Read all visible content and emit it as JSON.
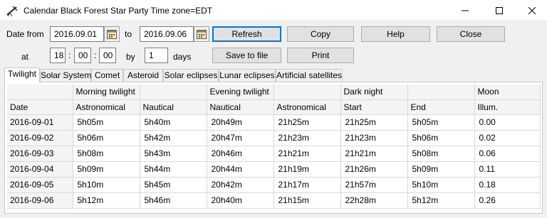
{
  "window": {
    "title": "Calendar Black Forest Star Party Time zone=EDT",
    "app_icon": "telescope-icon",
    "controls": [
      "minimize-icon",
      "maximize-icon",
      "close-icon"
    ]
  },
  "form": {
    "date_from_label": "Date from",
    "date_from": "2016.09.01",
    "to_label": "to",
    "date_to": "2016.09.06",
    "at_label": "at",
    "hour": "18",
    "minute": "00",
    "second": "00",
    "sep1": ":",
    "sep2": ":",
    "by_label": "by",
    "step": "1",
    "days_label": "days",
    "calendar_icon": "calendar-icon"
  },
  "buttons": {
    "refresh": "Refresh",
    "copy": "Copy",
    "help": "Help",
    "close": "Close",
    "save": "Save to file",
    "print": "Print"
  },
  "tabs": [
    "Twilight",
    "Solar System",
    "Comet",
    "Asteroid",
    "Solar eclipses",
    "Lunar eclipses",
    "Artificial satellites"
  ],
  "active_tab": "Twilight",
  "table": {
    "group_headers": [
      "",
      "Morning twilight",
      "",
      "Evening twilight",
      "",
      "Dark night",
      "",
      "Moon"
    ],
    "columns": [
      "Date",
      "Astronomical",
      "Nautical",
      "Nautical",
      "Astronomical",
      "Start",
      "End",
      "Illum."
    ],
    "rows": [
      [
        "2016-09-01",
        "5h05m",
        "5h40m",
        "20h49m",
        "21h25m",
        "21h25m",
        "5h05m",
        "0.00"
      ],
      [
        "2016-09-02",
        "5h06m",
        "5h42m",
        "20h47m",
        "21h23m",
        "21h23m",
        "5h06m",
        "0.02"
      ],
      [
        "2016-09-03",
        "5h08m",
        "5h43m",
        "20h46m",
        "21h21m",
        "21h21m",
        "5h08m",
        "0.06"
      ],
      [
        "2016-09-04",
        "5h09m",
        "5h44m",
        "20h44m",
        "21h19m",
        "21h26m",
        "5h09m",
        "0.11"
      ],
      [
        "2016-09-05",
        "5h10m",
        "5h45m",
        "20h42m",
        "21h17m",
        "21h57m",
        "5h10m",
        "0.18"
      ],
      [
        "2016-09-06",
        "5h12m",
        "5h46m",
        "20h40m",
        "21h15m",
        "22h28m",
        "5h12m",
        "0.26"
      ]
    ]
  }
}
